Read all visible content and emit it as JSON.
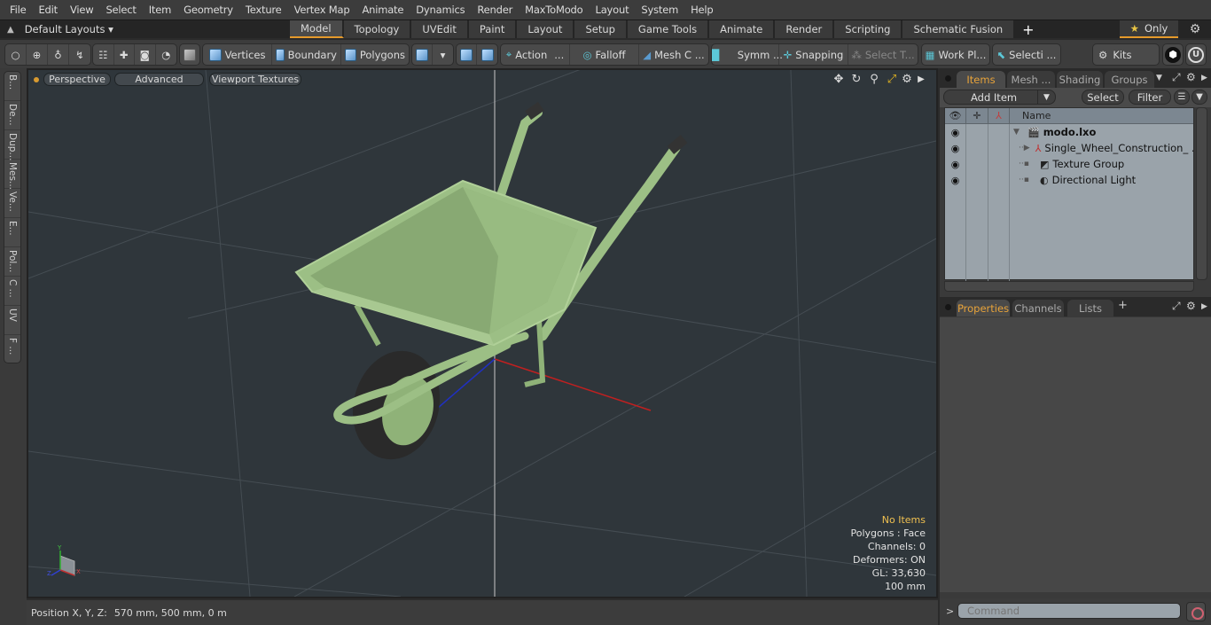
{
  "menu": [
    "File",
    "Edit",
    "View",
    "Select",
    "Item",
    "Geometry",
    "Texture",
    "Vertex Map",
    "Animate",
    "Dynamics",
    "Render",
    "MaxToModo",
    "Layout",
    "System",
    "Help"
  ],
  "layout_bar": {
    "layouts_label": "Default Layouts ▾",
    "tabs": [
      "Model",
      "Topology",
      "UVEdit",
      "Paint",
      "Layout",
      "Setup",
      "Game Tools",
      "Animate",
      "Render",
      "Scripting",
      "Schematic Fusion"
    ],
    "active_tab": "Model",
    "add_tab": "+",
    "only_label": "Only"
  },
  "toolbar": {
    "vertices": "Vertices",
    "boundary": "Boundary",
    "polygons": "Polygons",
    "action": "Action",
    "action_more": "...",
    "falloff": "Falloff",
    "mesh_c": "Mesh C ...",
    "symm": "Symm ...",
    "snapping": "Snapping",
    "select_t": "Select T...",
    "work_pl": "Work Pl...",
    "selecti": "Selecti ...",
    "kits": "Kits"
  },
  "left_tabs": [
    "B...",
    "De...",
    "Dup...",
    "Mes...",
    "Ve...",
    "E...",
    "Pol...",
    "C ...",
    "UV",
    "F ..."
  ],
  "viewport": {
    "perspective": "Perspective",
    "advanced": "Advanced",
    "viewport_textures": "Viewport Textures",
    "info": {
      "no_items": "No Items",
      "polygons": "Polygons : Face",
      "channels": "Channels: 0",
      "deformers": "Deformers: ON",
      "gl": "GL: 33,630",
      "scale": "100 mm"
    },
    "axis_labels": {
      "x": "X",
      "y": "Y",
      "z": "Z"
    }
  },
  "status": {
    "position_label": "Position X, Y, Z:",
    "position_value": "570 mm, 500 mm, 0 m"
  },
  "items_panel": {
    "tabs": [
      "Items",
      "Mesh ...",
      "Shading",
      "Groups"
    ],
    "active_tab": "Items",
    "add_item": "Add Item",
    "select": "Select",
    "filter": "Filter",
    "column_name": "Name",
    "tree": [
      {
        "label": "modo.lxo",
        "type": "scene",
        "bold": true
      },
      {
        "label": "Single_Wheel_Construction_ ...",
        "type": "mesh-group"
      },
      {
        "label": "Texture Group",
        "type": "texture-group"
      },
      {
        "label": "Directional Light",
        "type": "light"
      }
    ]
  },
  "props_panel": {
    "tabs": [
      "Properties",
      "Channels",
      "Lists"
    ],
    "active_tab": "Properties",
    "add_tab": "+"
  },
  "command": {
    "prompt": ">",
    "placeholder": "Command"
  },
  "colors": {
    "accent": "#e59a2b",
    "viewport_bg": "#2f363b",
    "model_green": "#9cbf85",
    "tire": "#2a2a2a"
  }
}
